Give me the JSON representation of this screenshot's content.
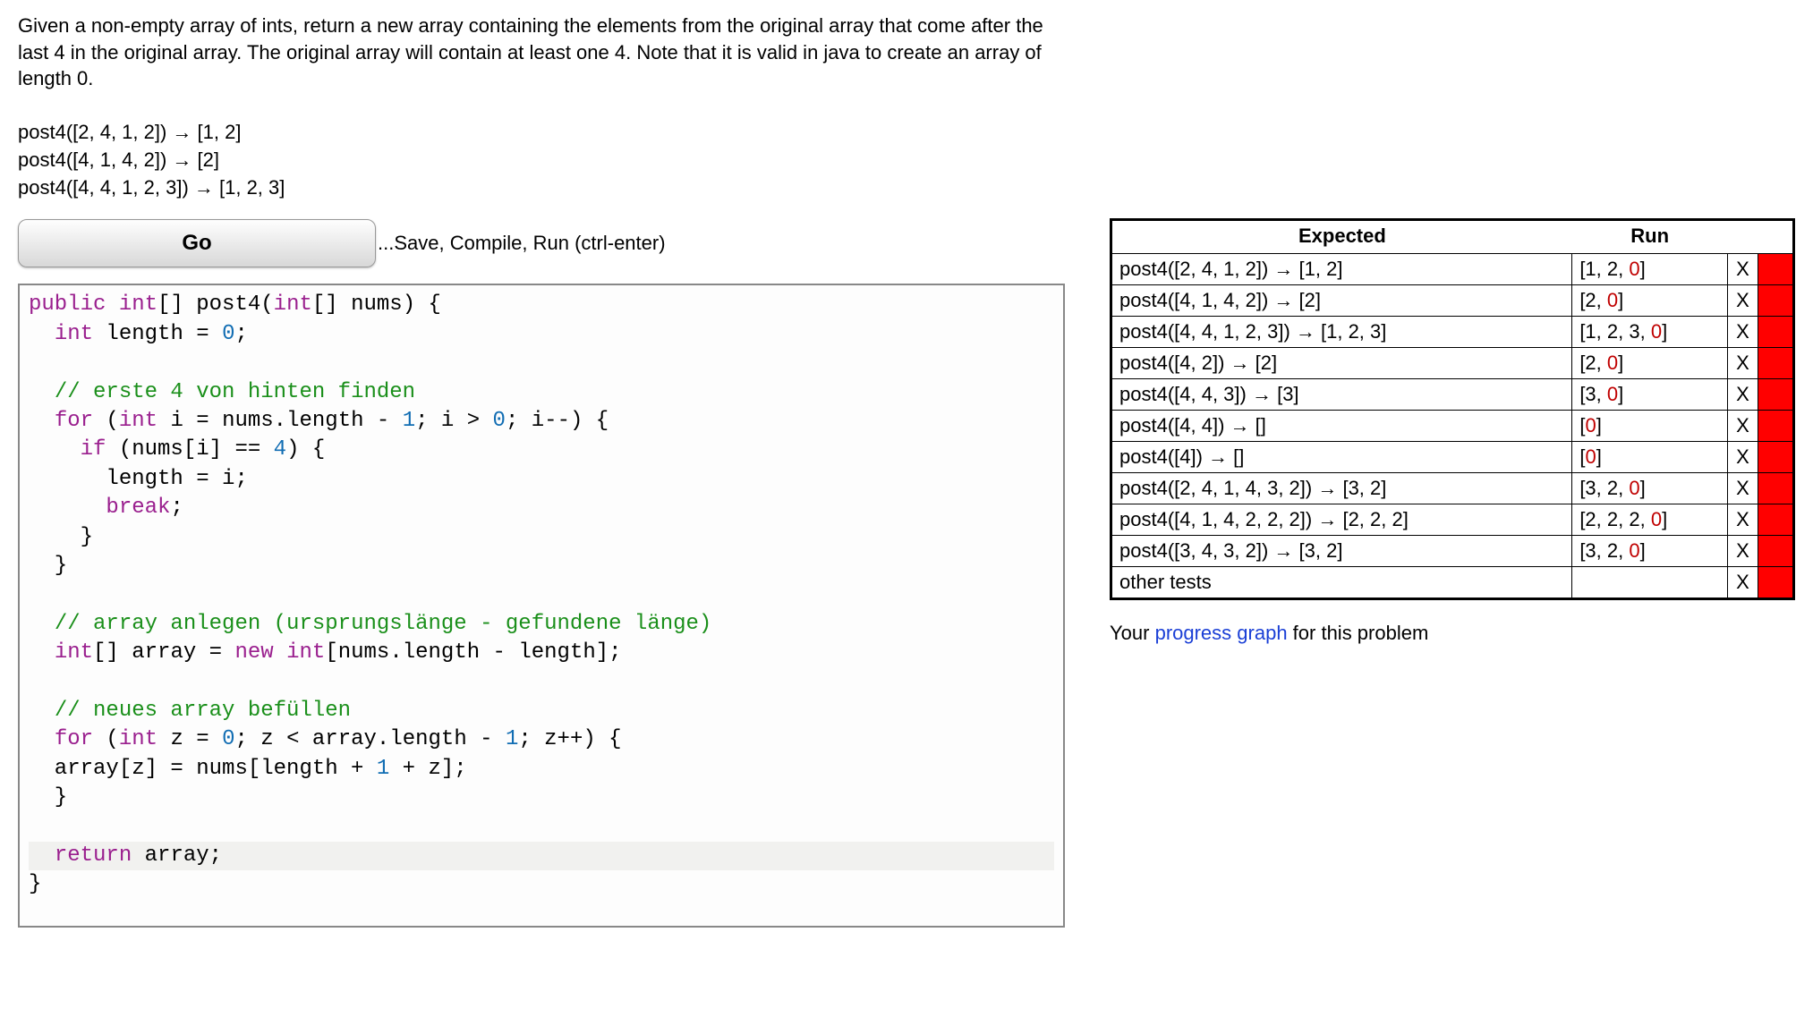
{
  "problem": {
    "description": "Given a non-empty array of ints, return a new array containing the elements from the original array that come after the last 4 in the original array. The original array will contain at least one 4. Note that it is valid in java to create an array of length 0.",
    "examples": [
      "post4([2, 4, 1, 2]) → [1, 2]",
      "post4([4, 1, 4, 2]) → [2]",
      "post4([4, 4, 1, 2, 3]) → [1, 2, 3]"
    ]
  },
  "controls": {
    "go_label": "Go",
    "hint": "...Save, Compile, Run (ctrl-enter)"
  },
  "code_raw": "public int[] post4(int[] nums) {\n  int length = 0;\n  \n  // erste 4 von hinten finden\n  for (int i = nums.length - 1; i > 0; i--) {\n    if (nums[i] == 4) {\n      length = i;\n      break;\n    }\n  }\n  \n  // array anlegen (ursprungslänge - gefundene länge)\n  int[] array = new int[nums.length - length];\n  \n  // neues array befüllen\n  for (int z = 0; z < array.length - 1; z++) {\n  array[z] = nums[length + 1 + z];\n  }\n  \n  return array;\n}",
  "results": {
    "headers": {
      "expected": "Expected",
      "run": "Run"
    },
    "rows": [
      {
        "expected": "post4([2, 4, 1, 2]) → [1, 2]",
        "run_pre": "[1, 2, ",
        "run_diff": "0",
        "run_post": "]",
        "mark": "X",
        "pass": false
      },
      {
        "expected": "post4([4, 1, 4, 2]) → [2]",
        "run_pre": "[2, ",
        "run_diff": "0",
        "run_post": "]",
        "mark": "X",
        "pass": false
      },
      {
        "expected": "post4([4, 4, 1, 2, 3]) → [1, 2, 3]",
        "run_pre": "[1, 2, 3, ",
        "run_diff": "0",
        "run_post": "]",
        "mark": "X",
        "pass": false
      },
      {
        "expected": "post4([4, 2]) → [2]",
        "run_pre": "[2, ",
        "run_diff": "0",
        "run_post": "]",
        "mark": "X",
        "pass": false
      },
      {
        "expected": "post4([4, 4, 3]) → [3]",
        "run_pre": "[3, ",
        "run_diff": "0",
        "run_post": "]",
        "mark": "X",
        "pass": false
      },
      {
        "expected": "post4([4, 4]) → []",
        "run_pre": "[",
        "run_diff": "0",
        "run_post": "]",
        "mark": "X",
        "pass": false
      },
      {
        "expected": "post4([4]) → []",
        "run_pre": "[",
        "run_diff": "0",
        "run_post": "]",
        "mark": "X",
        "pass": false
      },
      {
        "expected": "post4([2, 4, 1, 4, 3, 2]) → [3, 2]",
        "run_pre": "[3, 2, ",
        "run_diff": "0",
        "run_post": "]",
        "mark": "X",
        "pass": false
      },
      {
        "expected": "post4([4, 1, 4, 2, 2, 2]) → [2, 2, 2]",
        "run_pre": "[2, 2, 2, ",
        "run_diff": "0",
        "run_post": "]",
        "mark": "X",
        "pass": false
      },
      {
        "expected": "post4([3, 4, 3, 2]) → [3, 2]",
        "run_pre": "[3, 2, ",
        "run_diff": "0",
        "run_post": "]",
        "mark": "X",
        "pass": false
      }
    ],
    "other_tests_label": "other tests",
    "other_tests_mark": "X",
    "other_tests_pass": false
  },
  "progress": {
    "prefix": "Your ",
    "link": "progress graph",
    "suffix": " for this problem"
  }
}
